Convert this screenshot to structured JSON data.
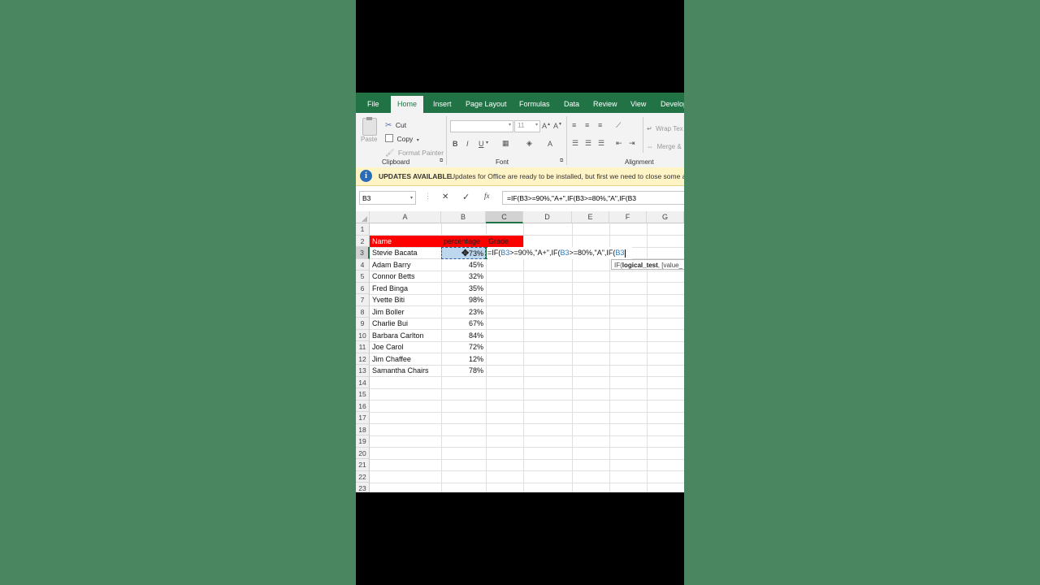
{
  "ribbon": {
    "tabs": [
      "File",
      "Home",
      "Insert",
      "Page Layout",
      "Formulas",
      "Data",
      "Review",
      "View",
      "Develop"
    ],
    "active_tab": "Home",
    "clipboard": {
      "paste_label": "Paste",
      "cut_label": "Cut",
      "copy_label": "Copy",
      "format_painter_label": "Format Painter",
      "group_label": "Clipboard"
    },
    "font": {
      "font_size": "11",
      "bold": "B",
      "italic": "I",
      "underline": "U",
      "group_label": "Font"
    },
    "alignment": {
      "wrap_text_label": "Wrap Tex",
      "merge_label": "Merge &",
      "group_label": "Alignment"
    }
  },
  "update_bar": {
    "title": "UPDATES AVAILABLE",
    "message": "Updates for Office are ready to be installed, but first we need to close some a"
  },
  "formula_bar": {
    "name_box": "B3",
    "cancel_symbol": "✕",
    "enter_symbol": "✓",
    "fx_label": "fx",
    "formula": "=IF(B3>=90%,\"A+\",IF(B3>=80%,\"A\",IF(B3"
  },
  "sheet": {
    "columns": [
      "A",
      "B",
      "C",
      "D",
      "E",
      "F",
      "G"
    ],
    "rows": [
      "1",
      "2",
      "3",
      "4",
      "5",
      "6",
      "7",
      "8",
      "9",
      "10",
      "11",
      "12",
      "13",
      "14",
      "15",
      "16",
      "17",
      "18",
      "19",
      "20",
      "21",
      "22",
      "23"
    ],
    "headers": {
      "name": "Name",
      "percentage": "percentage",
      "grade": "Grade"
    },
    "data": [
      {
        "name": "Stevie Bacata",
        "percentage": "73%"
      },
      {
        "name": "Adam Barry",
        "percentage": "45%"
      },
      {
        "name": "Connor Betts",
        "percentage": "32%"
      },
      {
        "name": "Fred Binga",
        "percentage": "35%"
      },
      {
        "name": "Yvette Biti",
        "percentage": "98%"
      },
      {
        "name": "Jim Boller",
        "percentage": "23%"
      },
      {
        "name": "Charlie Bui",
        "percentage": "67%"
      },
      {
        "name": "Barbara Carlton",
        "percentage": "84%"
      },
      {
        "name": "Joe Carol",
        "percentage": "72%"
      },
      {
        "name": "Jim Chaffee",
        "percentage": "12%"
      },
      {
        "name": "Samantha Chairs",
        "percentage": "78%"
      }
    ],
    "editing_formula": {
      "p1": "=IF(",
      "ref1": "B3",
      "p2": ">=90%,\"A+\",IF(",
      "ref2": "B3",
      "p3": ">=80%,\"A\",IF(",
      "ref3": "B3"
    },
    "tooltip": {
      "fn": "IF(",
      "arg": "logical_test",
      "rest": ", [value_"
    }
  },
  "colors": {
    "ribbon_green": "#217346",
    "header_red": "#ff0000",
    "selection_blue": "#bdd7ee",
    "reference_blue": "#2e75b6"
  }
}
